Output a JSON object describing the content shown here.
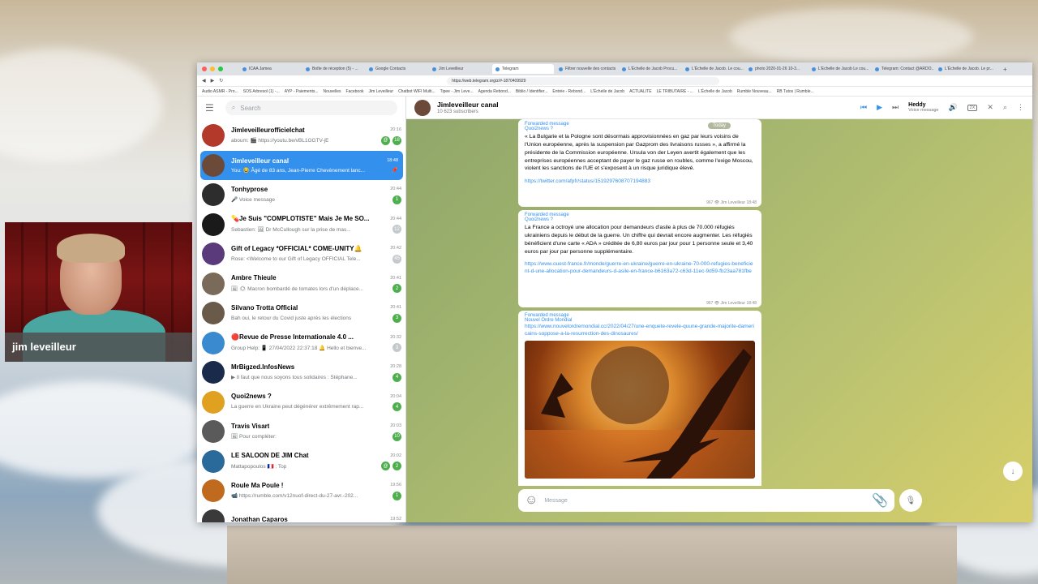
{
  "webcam": {
    "name_label": "jim leveilleur"
  },
  "browser": {
    "tabs": [
      "ICAA Jamea",
      "Boîte de réception (5) - ...",
      "Google Contacts",
      "Jim Leveilleur",
      "Telegram",
      "Filtrer nouvelle des contacts",
      "L'Échelle de Jacob Procu...",
      "L'Échelle de Jacob. Le cou...",
      "photo 2020-01-26 10-3...",
      "L'Echelle de Jacob Le cou...",
      "Telegram: Contact @ARDO...",
      "L'Échelle de Jacob. Le pr..."
    ],
    "url": "https://web.telegram.org/z/#-1870409929",
    "bookmarks": [
      "Audio ASMR - Pro...",
      "SOS Arbresol (1) -...",
      "AYP - Paiements...",
      "Nouvelles",
      "Facebook",
      "Jim Leveilleur",
      "Chatbot WIFI Multi...",
      "Tipee - Jim Leve...",
      "Agenda Rebond...",
      "Biblio / Identifier...",
      "Entrée - Rebond...",
      "L'Échelle de Jacob",
      "ACTUALITE",
      "LE TRIBUTAIRE - ...",
      "L'Échelle de Jacob",
      "Rumble Nouveau...",
      "RB Tutos | Rumble..."
    ]
  },
  "sidebar": {
    "search_placeholder": "Search",
    "chats": [
      {
        "title": "Jimleveilleurofficielchat",
        "time": "20:16",
        "preview": "aboum: 🎬 https://youtu.be/vBL1GGTV-jE",
        "badge": "18",
        "muted": false,
        "mention": true,
        "av": "#b33a2a"
      },
      {
        "title": "Jimleveilleur canal",
        "time": "18:48",
        "preview": "You: 😂 Âgé de 83 ans, Jean-Pierre Chevènement lanc...",
        "badge": "",
        "muted": false,
        "mention": false,
        "av": "#6b4a3a",
        "selected": true
      },
      {
        "title": "Tonhyprose",
        "time": "20:44",
        "preview": "🎤 Voice message",
        "badge": "1",
        "muted": false,
        "mention": false,
        "av": "#2d2d2d"
      },
      {
        "title": "💊Je Suis \"COMPLOTISTE\" Mais Je Me SO...",
        "time": "20:44",
        "preview": "Sebastien: 🖼 Dr McCullough sur la prise de mas...",
        "badge": "12",
        "muted": true,
        "mention": false,
        "av": "#1a1a1a"
      },
      {
        "title": "Gift of Legacy *OFFICIAL* COME-UNITY🔔",
        "time": "20:42",
        "preview": "Rose: <Welcome to our Gift of Legacy OFFICIAL Tele...",
        "badge": "45",
        "muted": true,
        "mention": false,
        "av": "#5a3a7a"
      },
      {
        "title": "Ambre Thieule",
        "time": "20:41",
        "preview": "🖼 ☀ Macron bombardé de tomates lors d'un déplace...",
        "badge": "2",
        "muted": false,
        "mention": false,
        "av": "#7a6a5a"
      },
      {
        "title": "Silvano Trotta Official",
        "time": "20:41",
        "preview": "Bah oui, le retour du Covid juste après les élections",
        "badge": "3",
        "muted": false,
        "mention": false,
        "av": "#6a5a4a"
      },
      {
        "title": "🔴Revue de Presse Internationale 4.0 ...",
        "time": "20:32",
        "preview": "Group Help: 📱 27/04/2022 22:37:18 🔔 Hello et bienve...",
        "badge": "3",
        "muted": true,
        "mention": false,
        "av": "#3a8ad0"
      },
      {
        "title": "MrBigzed.InfosNews",
        "time": "20:28",
        "preview": "▶ Il faut que nous soyons tous solidaires : Stéphane...",
        "badge": "4",
        "muted": false,
        "mention": false,
        "av": "#1a2a4a"
      },
      {
        "title": "Quoi2news ?",
        "time": "20:04",
        "preview": "La guerre en Ukraine peut dégénérer extrêmement rap...",
        "badge": "4",
        "muted": false,
        "mention": false,
        "av": "#e0a020"
      },
      {
        "title": "Travis Visart",
        "time": "20:03",
        "preview": "🖼 Pour compléter:",
        "badge": "10",
        "muted": false,
        "mention": false,
        "av": "#5a5a5a"
      },
      {
        "title": "LE SALOON DE JIM Chat",
        "time": "20:02",
        "preview": "Mattapopoulos 🇫🇷 : Top",
        "badge": "2",
        "muted": false,
        "mention": true,
        "av": "#2a6a9a"
      },
      {
        "title": "Roule Ma Poule !",
        "time": "19:56",
        "preview": "📹 https://rumble.com/v12nuof-direct-du-27-avr.-202...",
        "badge": "1",
        "muted": false,
        "mention": false,
        "av": "#c06a20"
      },
      {
        "title": "Jonathan Caparos",
        "time": "19:52",
        "preview": "",
        "badge": "",
        "muted": false,
        "mention": false,
        "av": "#3a3a3a"
      }
    ]
  },
  "header": {
    "title": "Jimleveilleur canal",
    "subtitle": "10 623 subscribers",
    "player_title": "Heddy",
    "player_sub": "Voice message",
    "speed": "2X"
  },
  "messages": {
    "date": "Today",
    "items": [
      {
        "forwarded": "Forwarded message",
        "source": "Quoi2news ?",
        "text": "« La Bulgarie et la Pologne sont désormais approvisionnées en gaz par leurs voisins de l'Union européenne, après la suspension par Gazprom des livraisons russes », a affirmé la présidente de la Commission européenne. Ursula von der Leyen avertit également que les entreprises européennes acceptant de payer le gaz russe en roubles, comme l'exige Moscou, violent les sanctions de l'UE et s'exposent à un risque juridique élevé.",
        "link": "https://twitter.com/afpfr/status/1519297608707194883",
        "meta": "967 👁 Jim Leveilleur 18:48"
      },
      {
        "forwarded": "Forwarded message",
        "source": "Quoi2news ?",
        "text": "La France a octroyé une allocation pour demandeurs d'asile à plus de 70.000 réfugiés ukrainiens depuis le début de la guerre. Un chiffre qui devrait encore augmenter. Les réfugiés bénéficient d'une carte « ADA » créditée de 6,80 euros par jour pour 1 personne seule et 3,40 euros par jour par personne supplémentaire.",
        "link": "https://www.ouest-france.fr/monde/guerre-en-ukraine/guerre-en-ukraine-70-000-refugies-beneficient-d-une-allocation-pour-demandeurs-d-asile-en-france-b6163a72-c63d-11ec-9d59-fb23aa781fbe",
        "meta": "967 👁 Jim Leveilleur 18:48"
      },
      {
        "forwarded": "Forwarded message",
        "source": "Nouvel Ordre Mondial",
        "text": "",
        "link": "https://www.nouvelordremondial.cc/2022/04/27/une-enquete-revele-quune-grande-majorite-damericains-soppose-a-la-resurrection-des-dinosaures/",
        "meta": ""
      }
    ]
  },
  "composer": {
    "placeholder": "Message"
  }
}
